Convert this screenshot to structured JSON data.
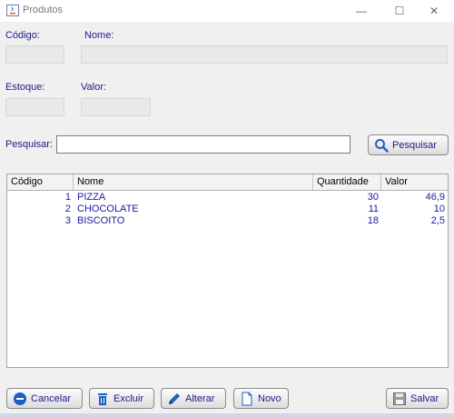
{
  "window": {
    "title": "Produtos",
    "minimize_glyph": "—",
    "maximize_glyph": "☐",
    "close_glyph": "✕"
  },
  "form": {
    "codigo_label": "Código:",
    "nome_label": "Nome:",
    "estoque_label": "Estoque:",
    "valor_label": "Valor:",
    "codigo_value": "",
    "nome_value": "",
    "estoque_value": "",
    "valor_value": ""
  },
  "search": {
    "label": "Pesquisar:",
    "value": "",
    "button_label": "Pesquisar"
  },
  "table": {
    "columns": [
      "Código",
      "Nome",
      "Quantidade",
      "Valor"
    ],
    "rows": [
      {
        "codigo": "1",
        "nome": "PIZZA",
        "quantidade": "30",
        "valor": "46,9"
      },
      {
        "codigo": "2",
        "nome": "CHOCOLATE",
        "quantidade": "11",
        "valor": "10"
      },
      {
        "codigo": "3",
        "nome": "BISCOITO",
        "quantidade": "18",
        "valor": "2,5"
      }
    ]
  },
  "buttons": {
    "cancelar": "Cancelar",
    "excluir": "Excluir",
    "alterar": "Alterar",
    "novo": "Novo",
    "salvar": "Salvar"
  },
  "colors": {
    "label_text": "#1a1a8c",
    "row_text": "#1a1aa0",
    "disabled_field": "#e9e9e7"
  }
}
